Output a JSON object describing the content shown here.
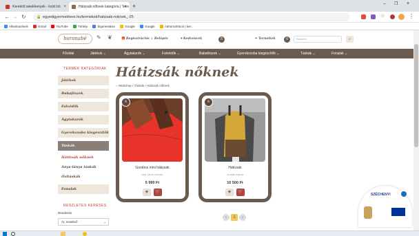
{
  "browser": {
    "tabs": [
      {
        "title": "Kerekítő weekhenyek - kolnl.hö",
        "active": false
      },
      {
        "title": "Hátizsák nőknek kategória | Tecn",
        "active": true
      }
    ],
    "new_tab": "+",
    "url": "egyedigyermekteve.hu/termekek/hatizsak-noknek_-25",
    "bookmarks": [
      "Alkalmazások",
      "Gmail",
      "YouTube",
      "Térkép",
      "Sigoriestásio",
      "Google",
      "Google",
      "Adminsztráció | ker..."
    ]
  },
  "site": {
    "logo": "baranabé",
    "header_links": [
      "Regisztrációs",
      "Belépés",
      "Kedvencek",
      "Termékek",
      "Kosár"
    ],
    "fav_count": "0",
    "cart_count": "0",
    "search_placeholder": "Keresés",
    "menu": [
      "Főoldal",
      "Játékok ⌄",
      "Ágytakarók ⌄",
      "Falvédők ⌄",
      "Babafészek ⌄",
      "Gyerekszoba kiegészítők ⌄",
      "Táskák ⌄",
      "Fonalak ⌄"
    ]
  },
  "sidebar": {
    "title": "TERMÉK KATEGÓRIÁK",
    "categories": [
      "Játékok",
      "Babafészek",
      "Falvédők",
      "Ágytakarók",
      "Gyerekszoba kiegészítők",
      "Táskák"
    ],
    "subcategories": [
      "Hátizsák nőknek",
      "Anya-lánya táskák",
      "Óvitáskák"
    ],
    "extra": "Fonalak",
    "filter_title": "RÉSZLETES KERESÉS",
    "filter_label": "Rendezés",
    "sort_value": "Ár, növekvő"
  },
  "main": {
    "title": "Hátizsák nőknek",
    "breadcrumb": [
      "Webshop",
      "Táskák",
      "Hátizsák nőknek"
    ],
    "products": [
      {
        "name": "Gombos mini hátizsák",
        "sub": "kép: piros-mérsél",
        "price": "5 990 Ft",
        "badge": "ö"
      },
      {
        "name": "Hátizsák",
        "sub": "mustár-barna",
        "price": "10 500 Ft",
        "badge": "ö"
      }
    ],
    "page": "1"
  },
  "colors": {
    "brown": "#6b5a4e",
    "accent": "#c0392b",
    "beige": "#efe6dc"
  }
}
